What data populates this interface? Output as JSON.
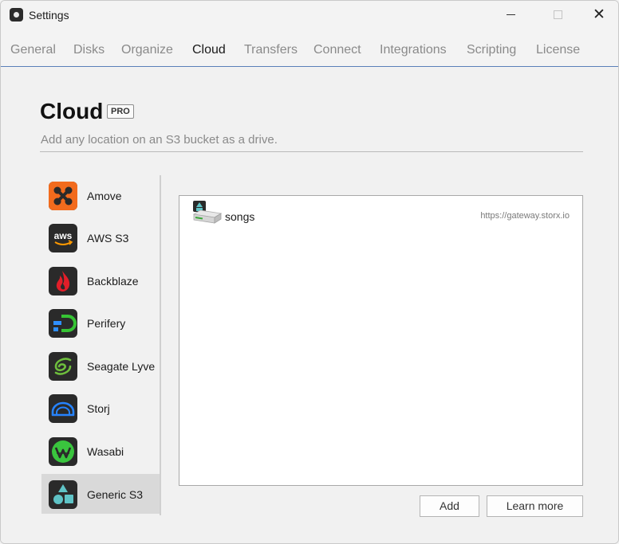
{
  "window": {
    "title": "Settings"
  },
  "tabs": [
    {
      "label": "General"
    },
    {
      "label": "Disks"
    },
    {
      "label": "Organize"
    },
    {
      "label": "Cloud",
      "active": true
    },
    {
      "label": "Transfers"
    },
    {
      "label": "Connect"
    },
    {
      "label": "Integrations"
    },
    {
      "label": "Scripting"
    },
    {
      "label": "License"
    }
  ],
  "page": {
    "title": "Cloud",
    "badge": "PRO",
    "subtitle": "Add any location on an S3 bucket as a drive."
  },
  "providers": [
    {
      "label": "Amove",
      "icon": "amove-icon",
      "color": "#f26b1d"
    },
    {
      "label": "AWS S3",
      "icon": "aws-icon",
      "color": "#ff9900"
    },
    {
      "label": "Backblaze",
      "icon": "backblaze-flame-icon",
      "color": "#e21e29"
    },
    {
      "label": "Perifery",
      "icon": "perifery-icon",
      "color": "#36c434"
    },
    {
      "label": "Seagate Lyve",
      "icon": "seagate-swirl-icon",
      "color": "#6ebe3d"
    },
    {
      "label": "Storj",
      "icon": "storj-cloud-icon",
      "color": "#2683ff"
    },
    {
      "label": "Wasabi",
      "icon": "wasabi-icon",
      "color": "#3ac53e"
    },
    {
      "label": "Generic S3",
      "icon": "generic-s3-shapes-icon",
      "color": "#5fc3c6",
      "selected": true
    }
  ],
  "drives": [
    {
      "name": "songs",
      "url": "https://gateway.storx.io"
    }
  ],
  "buttons": {
    "add": "Add",
    "learn_more": "Learn more"
  },
  "icons": {
    "app": "settings-app-icon",
    "minimize": "minimize-icon",
    "maximize": "maximize-icon",
    "close": "close-icon",
    "drive": "cloud-drive-icon"
  }
}
